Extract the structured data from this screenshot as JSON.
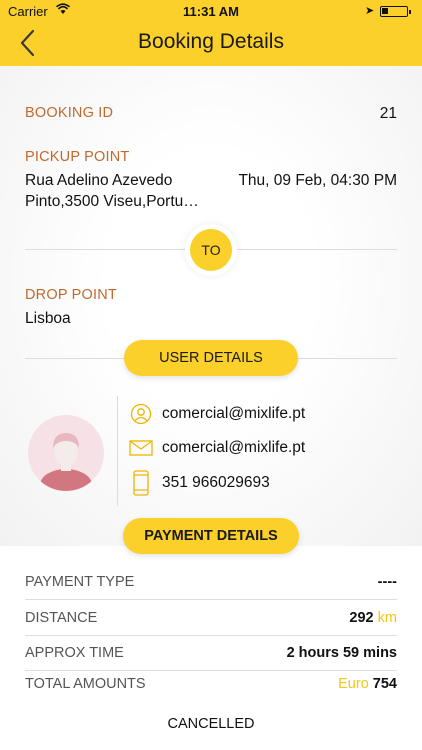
{
  "status_bar": {
    "carrier": "Carrier",
    "time": "11:31 AM"
  },
  "header": {
    "title": "Booking Details"
  },
  "booking": {
    "id_label": "BOOKING ID",
    "id_value": "21",
    "pickup_label": "PICKUP POINT",
    "pickup_address_line1": "Rua Adelino Azevedo",
    "pickup_address_line2": "Pinto,3500 Viseu,Portu…",
    "pickup_datetime": "Thu, 09 Feb, 04:30 PM",
    "to_label": "TO",
    "drop_label": "DROP POINT",
    "drop_value": "Lisboa"
  },
  "user_details": {
    "button_label": "USER DETAILS",
    "contacts": [
      {
        "icon": "user-icon",
        "text": "comercial@mixlife.pt"
      },
      {
        "icon": "mail-icon",
        "text": "comercial@mixlife.pt"
      },
      {
        "icon": "phone-icon",
        "text": "351 966029693"
      }
    ]
  },
  "payment_details": {
    "button_label": "PAYMENT DETAILS",
    "payment_type_label": "PAYMENT TYPE",
    "payment_type_value": "----",
    "distance_label": "DISTANCE",
    "distance_value": "292",
    "distance_unit": "km",
    "time_label": "APPROX TIME",
    "time_value": "2 hours 59 mins",
    "total_label": "TOTAL AMOUNTS",
    "total_currency": "Euro",
    "total_value": "754"
  },
  "booking_status": "CANCELLED",
  "colors": {
    "accent": "#fbd02a",
    "label": "#c06a2f"
  }
}
